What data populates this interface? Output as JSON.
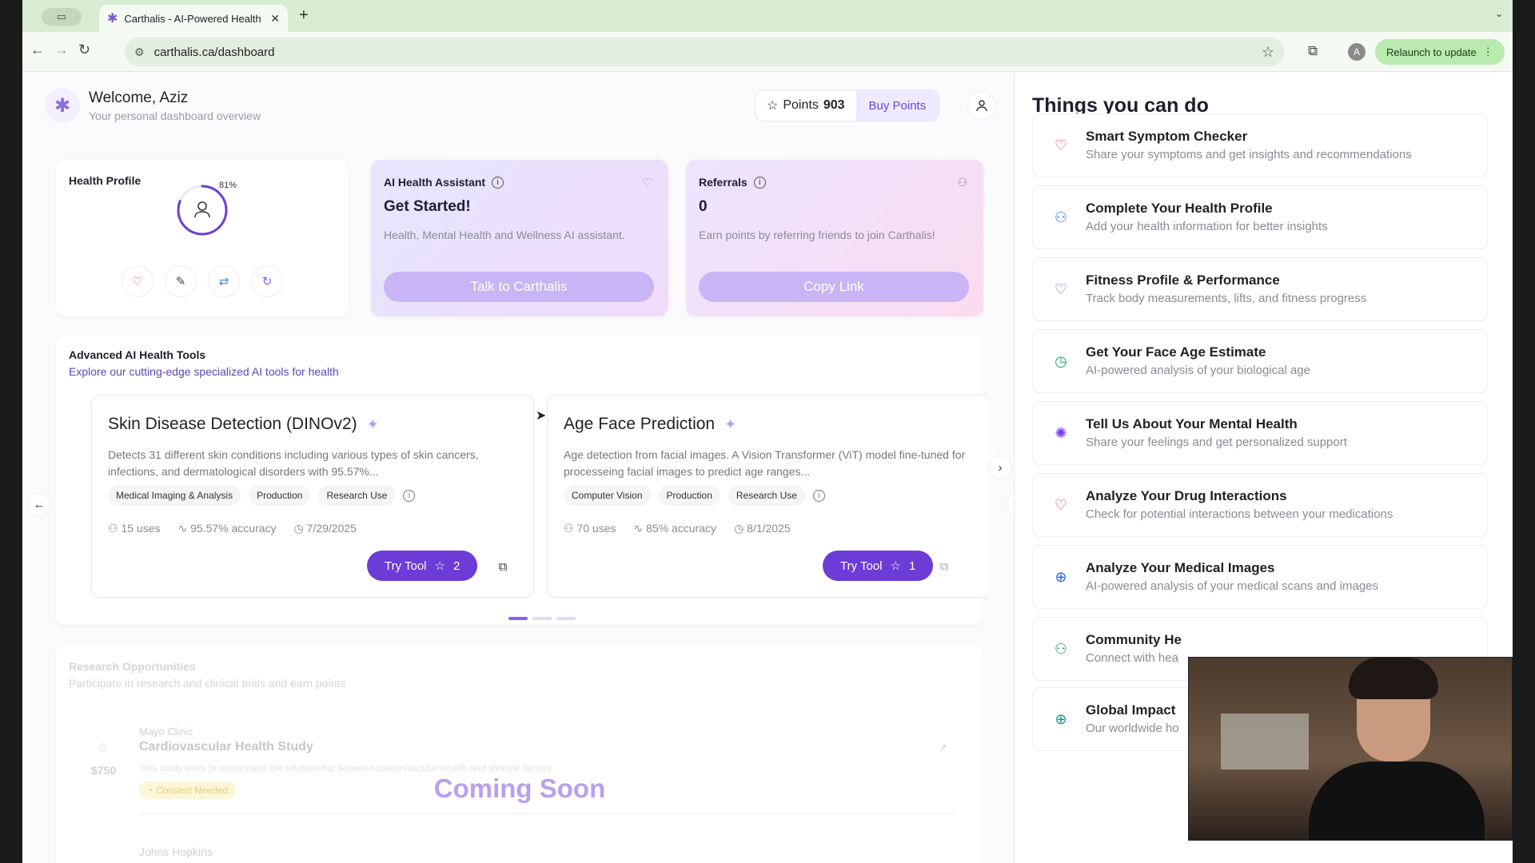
{
  "browser": {
    "tab_title": "Carthalis - AI-Powered Health",
    "url": "carthalis.ca/dashboard",
    "profile_initial": "A",
    "relaunch_label": "Relaunch to update"
  },
  "header": {
    "welcome": "Welcome, Aziz",
    "subtitle": "Your personal dashboard overview",
    "points_label": "Points",
    "points_value": "903",
    "buy_points": "Buy Points"
  },
  "health_profile": {
    "title": "Health Profile",
    "percent_label": "81%",
    "completion": 0.81
  },
  "ai_assistant": {
    "title": "AI Health Assistant",
    "headline": "Get Started!",
    "description": "Health, Mental Health and Wellness AI assistant.",
    "cta": "Talk to Carthalis"
  },
  "referrals": {
    "title": "Referrals",
    "count": "0",
    "description": "Earn points by referring friends to join Carthalis!",
    "cta": "Copy Link"
  },
  "tools": {
    "title": "Advanced AI Health Tools",
    "subtitle": "Explore our cutting-edge specialized AI tools for health",
    "cards": [
      {
        "name": "Skin Disease Detection (DINOv2)",
        "description": "Detects 31 different skin conditions including various types of skin cancers, infections, and dermatological disorders with 95.57%...",
        "tags": [
          "Medical Imaging & Analysis",
          "Production",
          "Research Use"
        ],
        "uses": "15 uses",
        "accuracy": "95.57% accuracy",
        "date": "7/29/2025",
        "try_label": "Try Tool",
        "stars": "2"
      },
      {
        "name": "Age Face Prediction",
        "description": "Age detection from facial images. A Vision Transformer (ViT) model fine-tuned for processeing facial images to predict age ranges...",
        "tags": [
          "Computer Vision",
          "Production",
          "Research Use"
        ],
        "uses": "70 uses",
        "accuracy": "85% accuracy",
        "date": "8/1/2025",
        "try_label": "Try Tool",
        "stars": "1"
      }
    ]
  },
  "research": {
    "title": "Research Opportunities",
    "subtitle": "Participate in research and clinical trials and earn points",
    "studies": [
      {
        "org": "Mayo Clinic",
        "name": "Cardiovascular Health Study",
        "amount": "$750",
        "description": "This study aims to understand the relationship between cardiovascular health and lifestyle factors.",
        "status": "Consent Needed"
      },
      {
        "org": "Johns Hopkins"
      }
    ],
    "overlay": "Coming Soon"
  },
  "actions": {
    "title": "Things you can do",
    "items": [
      {
        "title": "Smart Symptom Checker",
        "desc": "Share your symptoms and get insights and recommendations",
        "icon": "heart-pulse-icon",
        "color": "#e0475c"
      },
      {
        "title": "Complete Your Health Profile",
        "desc": "Add your health information for better insights",
        "icon": "user-edit-icon",
        "color": "#3b82f6"
      },
      {
        "title": "Fitness Profile & Performance",
        "desc": "Track body measurements, lifts, and fitness progress",
        "icon": "heart-icon",
        "color": "#8b5cf6"
      },
      {
        "title": "Get Your Face Age Estimate",
        "desc": "AI-powered analysis of your biological age",
        "icon": "clock-icon",
        "color": "#22a55a"
      },
      {
        "title": "Tell Us About Your Mental Health",
        "desc": "Share your feelings and get personalized support",
        "icon": "brain-icon",
        "color": "#7c3aed"
      },
      {
        "title": "Analyze Your Drug Interactions",
        "desc": "Check for potential interactions between your medications",
        "icon": "heart-icon",
        "color": "#e0475c"
      },
      {
        "title": "Analyze Your Medical Images",
        "desc": "AI-powered analysis of your medical scans and images",
        "icon": "globe-icon",
        "color": "#2563eb"
      },
      {
        "title": "Community He",
        "desc": "Connect with hea",
        "icon": "users-icon",
        "color": "#22a55a"
      },
      {
        "title": "Global Impact",
        "desc": "Our worldwide ho",
        "icon": "globe-icon",
        "color": "#0d9488"
      }
    ]
  }
}
